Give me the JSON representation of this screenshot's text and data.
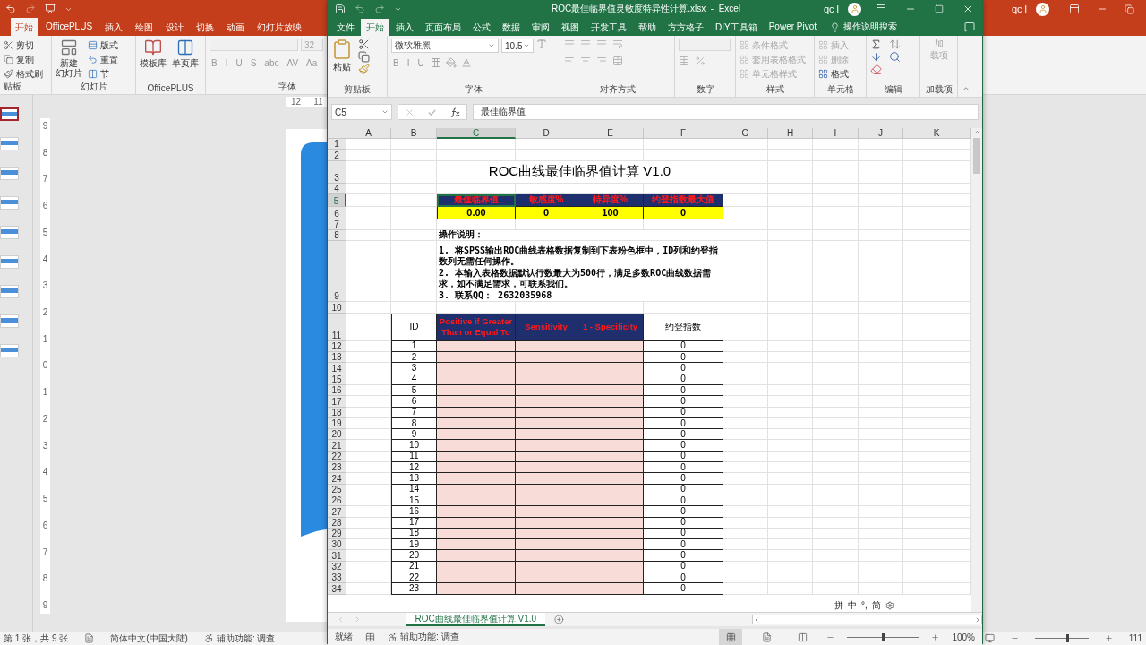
{
  "powerpoint": {
    "tabs": [
      {
        "label": "开始",
        "selected": true
      },
      {
        "label": "OfficePLUS",
        "selected": false
      },
      {
        "label": "插入",
        "selected": false
      },
      {
        "label": "绘图",
        "selected": false
      },
      {
        "label": "设计",
        "selected": false
      },
      {
        "label": "切换",
        "selected": false
      },
      {
        "label": "动画",
        "selected": false
      },
      {
        "label": "幻灯片放映",
        "selected": false
      }
    ],
    "clipboard": {
      "items": [
        "剪切",
        "复制",
        "格式刷"
      ],
      "label": "贴板"
    },
    "slides_group": {
      "new_slide": [
        "新建",
        "幻灯片"
      ],
      "items": [
        "版式",
        "重置",
        "节"
      ],
      "label": "幻灯片"
    },
    "officeplus_group": {
      "items": [
        "模板库",
        "单页库"
      ],
      "label": "OfficePLUS"
    },
    "font_group": {
      "size": "32",
      "buttons": [
        "B",
        "I",
        "U",
        "S",
        "abc",
        "AV",
        "Aa"
      ],
      "label": "字体"
    },
    "ruler": [
      "12",
      "11"
    ],
    "vertical_ruler": [
      "9",
      "8",
      "7",
      "6",
      "5",
      "4",
      "3",
      "2",
      "1",
      "0",
      "1",
      "2",
      "3",
      "4",
      "5",
      "6",
      "7",
      "8",
      "9"
    ],
    "slides": [
      {
        "selected": true
      },
      {
        "selected": false
      },
      {
        "selected": false
      },
      {
        "selected": false
      },
      {
        "selected": false
      },
      {
        "selected": false
      },
      {
        "selected": false
      },
      {
        "selected": false
      },
      {
        "selected": false
      }
    ],
    "user": "qc l",
    "status_bar": {
      "slide_info": "第 1 张，共 9 张",
      "language": "简体中文(中国大陆)",
      "accessibility": "辅助功能: 调查",
      "zoom": "111",
      "zoom_slider": {
        "level": 0.6
      }
    }
  },
  "excel": {
    "title": "ROC最佳临界值灵敏度特异性计算.xlsx  -  Excel",
    "user": "qc l",
    "tabs": [
      {
        "label": "文件",
        "selected": false
      },
      {
        "label": "开始",
        "selected": true
      },
      {
        "label": "插入",
        "selected": false
      },
      {
        "label": "页面布局",
        "selected": false
      },
      {
        "label": "公式",
        "selected": false
      },
      {
        "label": "数据",
        "selected": false
      },
      {
        "label": "审阅",
        "selected": false
      },
      {
        "label": "视图",
        "selected": false
      },
      {
        "label": "开发工具",
        "selected": false
      },
      {
        "label": "帮助",
        "selected": false
      },
      {
        "label": "方方格子",
        "selected": false
      },
      {
        "label": "DIY工具箱",
        "selected": false
      },
      {
        "label": "Power Pivot",
        "selected": false
      }
    ],
    "search": "操作说明搜索",
    "ribbon": [
      {
        "kind": "clipboard",
        "label": "剪贴板",
        "paste": "粘贴"
      },
      {
        "kind": "font",
        "label": "字体",
        "font": "微软雅黑",
        "size": "10.5",
        "buttons": [
          "B",
          "I",
          "U"
        ]
      },
      {
        "kind": "alignment",
        "label": "对齐方式"
      },
      {
        "kind": "number",
        "label": "数字"
      },
      {
        "kind": "list",
        "label": "样式",
        "items": [
          {
            "text": "条件格式",
            "disabled": true
          },
          {
            "text": "套用表格格式",
            "disabled": true
          },
          {
            "text": "单元格样式",
            "disabled": true
          }
        ]
      },
      {
        "kind": "list",
        "label": "单元格",
        "items": [
          {
            "text": "插入",
            "disabled": true
          },
          {
            "text": "删除",
            "disabled": true
          },
          {
            "text": "格式",
            "disabled": false
          }
        ]
      },
      {
        "kind": "editing",
        "label": "编辑"
      },
      {
        "kind": "addin",
        "label": "加载项",
        "button": [
          "加",
          "载项"
        ]
      }
    ],
    "name_box": "C5",
    "formula": "最佳临界值",
    "columns": [
      {
        "label": "A",
        "selected": false
      },
      {
        "label": "B",
        "selected": false
      },
      {
        "label": "C",
        "selected": true
      },
      {
        "label": "D",
        "selected": false
      },
      {
        "label": "E",
        "selected": false
      },
      {
        "label": "F",
        "selected": false
      },
      {
        "label": "G",
        "selected": false
      },
      {
        "label": "H",
        "selected": false
      },
      {
        "label": "I",
        "selected": false
      },
      {
        "label": "J",
        "selected": false
      },
      {
        "label": "K",
        "selected": false
      }
    ],
    "rows": [
      {
        "number": "1",
        "kind": "blank",
        "selected": false
      },
      {
        "number": "2",
        "kind": "blank",
        "selected": false
      },
      {
        "number": "3",
        "kind": "title",
        "selected": false,
        "text": "ROC曲线最佳临界值计算 V1.0"
      },
      {
        "number": "4",
        "kind": "blank",
        "selected": false
      },
      {
        "number": "5",
        "kind": "header_band",
        "selected": true,
        "cells": [
          {
            "text": "最佳临界值",
            "selected": true
          },
          {
            "text": "敏感度%",
            "selected": false
          },
          {
            "text": "特异度%",
            "selected": false
          },
          {
            "text": "约登指数最大值",
            "selected": false
          }
        ]
      },
      {
        "number": "6",
        "kind": "value_band",
        "selected": false,
        "cells": [
          "0.00",
          "0",
          "100",
          "0"
        ]
      },
      {
        "number": "7",
        "kind": "blank",
        "selected": false
      },
      {
        "number": "8",
        "kind": "note_heading",
        "selected": false,
        "text": "操作说明："
      },
      {
        "number": "9",
        "kind": "notes",
        "selected": false,
        "lines": [
          "1. 将SPSS输出ROC曲线表格数据复制到下表粉色框中，ID列和约登指数列无需任何操作。",
          "2. 本输入表格数据默认行数最大为500行，满足多数ROC曲线数据需求，如不满足需求，可联系我们。",
          "3. 联系QQ： 2632035968"
        ]
      },
      {
        "number": "10",
        "kind": "blank",
        "selected": false
      },
      {
        "number": "11",
        "kind": "table_header",
        "selected": false,
        "cells": [
          {
            "text": "ID",
            "kind": "plain"
          },
          {
            "text": "Positive if Greater Than or Equal To",
            "kind": "input"
          },
          {
            "text": "Sensitivity",
            "kind": "input"
          },
          {
            "text": "1 - Specificity",
            "kind": "input"
          },
          {
            "text": "约登指数",
            "kind": "plain"
          }
        ]
      },
      {
        "number": "12",
        "kind": "data",
        "selected": false,
        "id": "1",
        "youden": "0"
      },
      {
        "number": "13",
        "kind": "data",
        "selected": false,
        "id": "2",
        "youden": "0"
      },
      {
        "number": "14",
        "kind": "data",
        "selected": false,
        "id": "3",
        "youden": "0"
      },
      {
        "number": "15",
        "kind": "data",
        "selected": false,
        "id": "4",
        "youden": "0"
      },
      {
        "number": "16",
        "kind": "data",
        "selected": false,
        "id": "5",
        "youden": "0"
      },
      {
        "number": "17",
        "kind": "data",
        "selected": false,
        "id": "6",
        "youden": "0"
      },
      {
        "number": "18",
        "kind": "data",
        "selected": false,
        "id": "7",
        "youden": "0"
      },
      {
        "number": "19",
        "kind": "data",
        "selected": false,
        "id": "8",
        "youden": "0"
      },
      {
        "number": "20",
        "kind": "data",
        "selected": false,
        "id": "9",
        "youden": "0"
      },
      {
        "number": "21",
        "kind": "data",
        "selected": false,
        "id": "10",
        "youden": "0"
      },
      {
        "number": "22",
        "kind": "data",
        "selected": false,
        "id": "11",
        "youden": "0"
      },
      {
        "number": "23",
        "kind": "data",
        "selected": false,
        "id": "12",
        "youden": "0"
      },
      {
        "number": "24",
        "kind": "data",
        "selected": false,
        "id": "13",
        "youden": "0"
      },
      {
        "number": "25",
        "kind": "data",
        "selected": false,
        "id": "14",
        "youden": "0"
      },
      {
        "number": "26",
        "kind": "data",
        "selected": false,
        "id": "15",
        "youden": "0"
      },
      {
        "number": "27",
        "kind": "data",
        "selected": false,
        "id": "16",
        "youden": "0"
      },
      {
        "number": "28",
        "kind": "data",
        "selected": false,
        "id": "17",
        "youden": "0"
      },
      {
        "number": "29",
        "kind": "data",
        "selected": false,
        "id": "18",
        "youden": "0"
      },
      {
        "number": "30",
        "kind": "data",
        "selected": false,
        "id": "19",
        "youden": "0"
      },
      {
        "number": "31",
        "kind": "data",
        "selected": false,
        "id": "20",
        "youden": "0"
      },
      {
        "number": "32",
        "kind": "data",
        "selected": false,
        "id": "21",
        "youden": "0"
      },
      {
        "number": "33",
        "kind": "data",
        "selected": false,
        "id": "22",
        "youden": "0"
      },
      {
        "number": "34",
        "kind": "data",
        "selected": false,
        "id": "23",
        "youden": "0"
      }
    ],
    "sheet_tab": {
      "label": "ROC曲线最佳临界值计算 V1.0",
      "selected": true
    },
    "status": "就绪",
    "accessibility": "辅助功能: 调查",
    "zoom": "100%",
    "zoom_slider": {
      "level": 0.5
    },
    "ime": [
      "拼",
      "中",
      "°,",
      "简"
    ]
  }
}
